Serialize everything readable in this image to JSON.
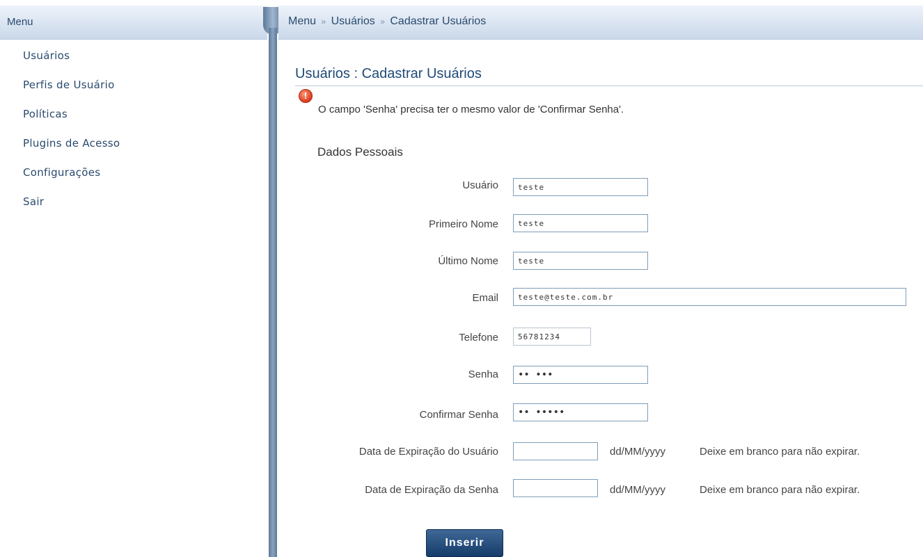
{
  "sidebar": {
    "header": "Menu",
    "items": [
      {
        "label": "Usuários"
      },
      {
        "label": "Perfis de Usuário"
      },
      {
        "label": "Políticas"
      },
      {
        "label": "Plugins de Acesso"
      },
      {
        "label": "Configurações"
      },
      {
        "label": "Sair"
      }
    ]
  },
  "breadcrumb": {
    "items": [
      "Menu",
      "Usuários",
      "Cadastrar Usuários"
    ],
    "separator": "»"
  },
  "page": {
    "title": "Usuários : Cadastrar Usuários",
    "error_icon": "error-icon",
    "error_message": "O campo 'Senha' precisa ter o mesmo valor de 'Confirmar Senha'.",
    "section_title": "Dados Pessoais"
  },
  "form": {
    "usuario": {
      "label": "Usuário",
      "value": "teste"
    },
    "primeiro_nome": {
      "label": "Primeiro Nome",
      "value": "teste"
    },
    "ultimo_nome": {
      "label": "Último Nome",
      "value": "teste"
    },
    "email": {
      "label": "Email",
      "value": "teste@teste.com.br"
    },
    "telefone": {
      "label": "Telefone",
      "value": "56781234"
    },
    "senha": {
      "label": "Senha",
      "value": "•• •••"
    },
    "confirmar_senha": {
      "label": "Confirmar Senha",
      "value": "•• •••••"
    },
    "exp_usuario": {
      "label": "Data de Expiração do Usuário",
      "value": "",
      "format": "dd/MM/yyyy",
      "hint": "Deixe em branco para não expirar."
    },
    "exp_senha": {
      "label": "Data de Expiração da Senha",
      "value": "",
      "format": "dd/MM/yyyy",
      "hint": "Deixe em branco para não expirar."
    },
    "submit_label": "Inserir"
  },
  "colors": {
    "header_gradient": "#c9d8ea",
    "link": "#2a4a6e",
    "title": "#1f4a78",
    "button": "#163c69",
    "error": "#d93b1f"
  }
}
